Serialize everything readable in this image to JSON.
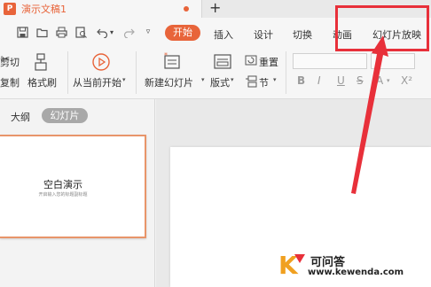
{
  "titlebar": {
    "app_icon": "P",
    "doc_title": "演示文稿1",
    "new_tab": "+"
  },
  "quick_access": [
    "save-icon",
    "open-folder-icon",
    "print-icon",
    "print-preview-icon",
    "undo-icon",
    "redo-icon",
    "dropdown-icon"
  ],
  "menu": {
    "active": "开始",
    "items": [
      "插入",
      "设计",
      "切换",
      "动画",
      "幻灯片放映"
    ]
  },
  "ribbon": {
    "cut": "剪切",
    "copy": "复制",
    "format_painter": "格式刷",
    "from_current": "从当前开始",
    "new_slide": "新建幻灯片",
    "layout": "版式",
    "reset": "重置",
    "section": "节",
    "format_buttons": [
      "B",
      "I",
      "U",
      "S",
      "A",
      "X²"
    ]
  },
  "left_panel": {
    "tab_outline": "大纲",
    "tab_slides": "幻灯片",
    "thumbnail": {
      "title": "空白演示",
      "subtitle": "开启输入您的标题副标题"
    }
  },
  "watermark": {
    "logo_letter": "K",
    "name": "可问答",
    "url": "www.kewenda.com"
  },
  "colors": {
    "accent": "#e8643a",
    "annotation": "#e8303a"
  }
}
